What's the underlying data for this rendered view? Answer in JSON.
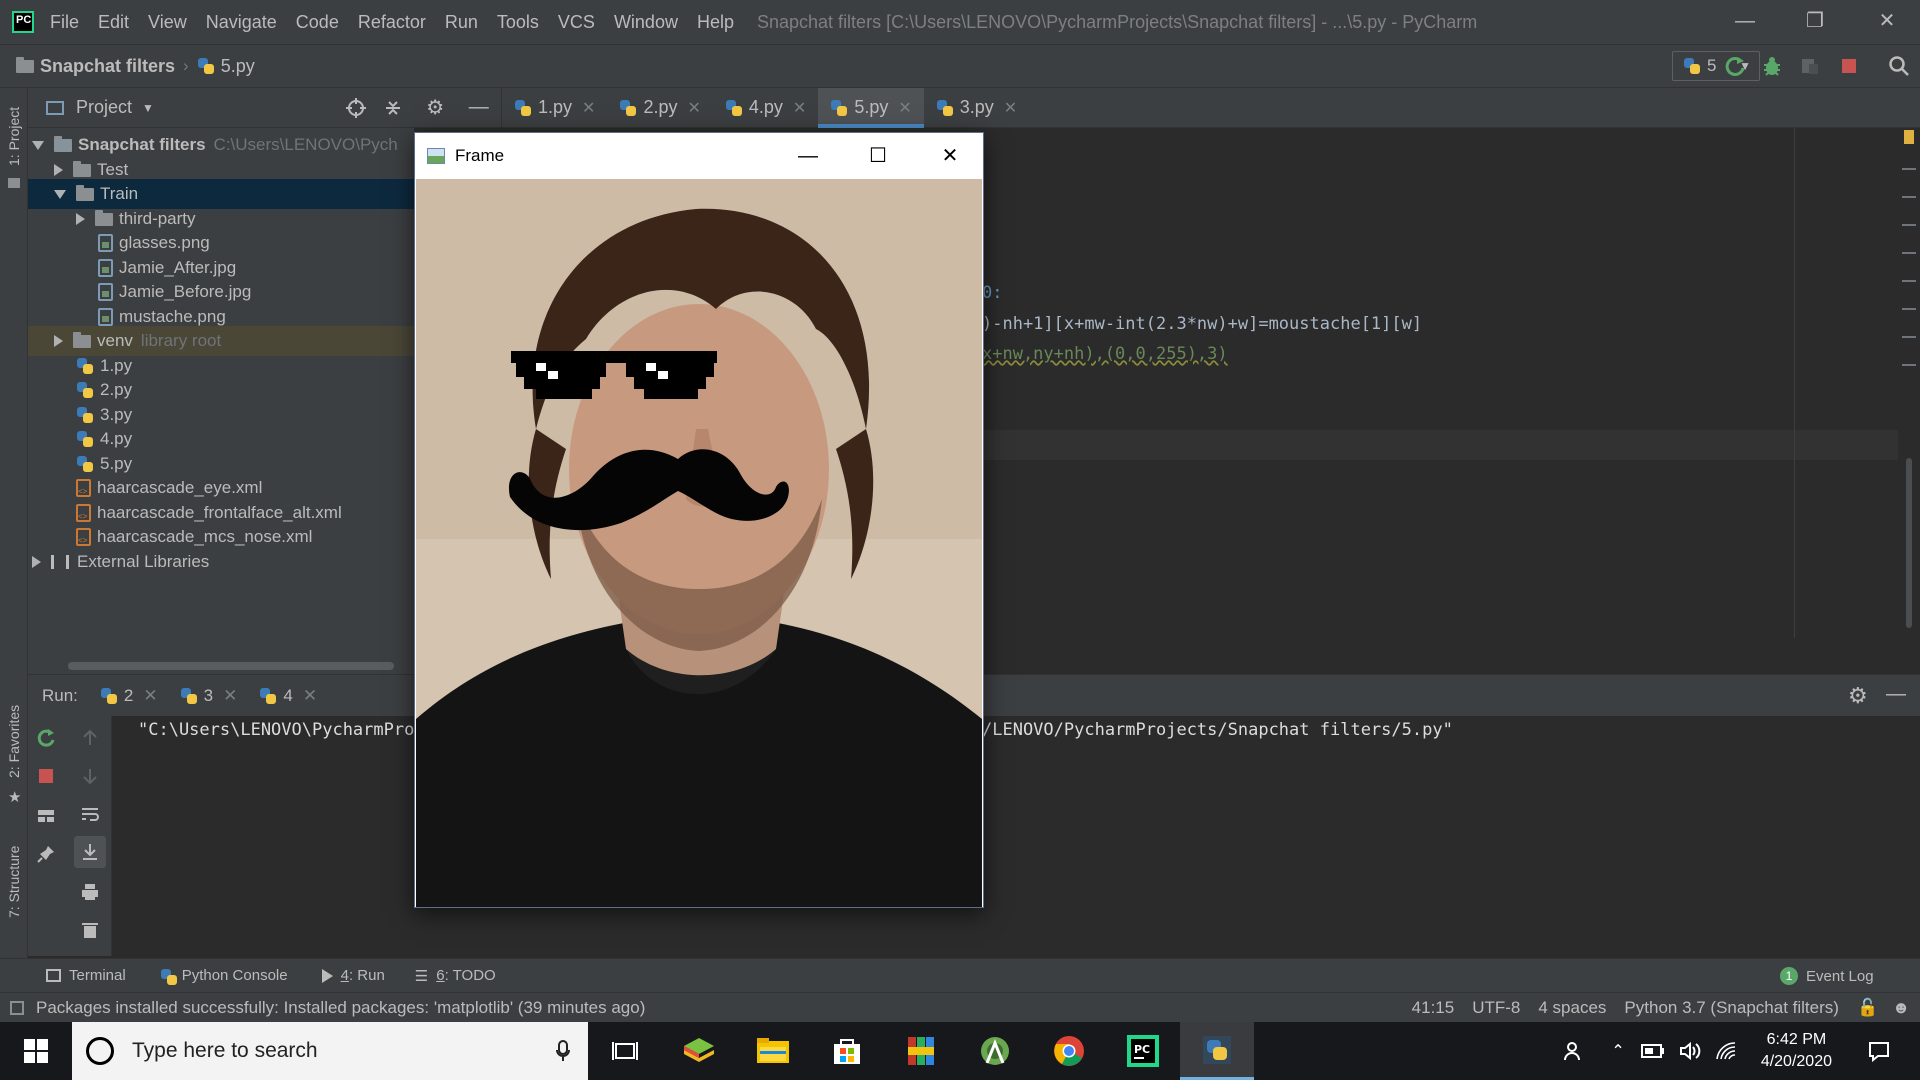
{
  "titlebar": {
    "logo_text": "PC",
    "menu": [
      "File",
      "Edit",
      "View",
      "Navigate",
      "Code",
      "Refactor",
      "Run",
      "Tools",
      "VCS",
      "Window",
      "Help"
    ],
    "window_title": "Snapchat filters [C:\\Users\\LENOVO\\PycharmProjects\\Snapchat filters] - ...\\5.py - PyCharm"
  },
  "navbar": {
    "project": "Snapchat filters",
    "file": "5.py",
    "run_config": "5"
  },
  "sidebar_left": {
    "project_label": "1: Project",
    "favorites_label": "2: Favorites",
    "structure_label": "7: Structure"
  },
  "project_panel": {
    "header": "Project",
    "root_name": "Snapchat filters",
    "root_path": "C:\\Users\\LENOVO\\Pych",
    "items": [
      {
        "name": "Test",
        "kind": "folder"
      },
      {
        "name": "Train",
        "kind": "folder"
      },
      {
        "name": "third-party",
        "kind": "folder"
      },
      {
        "name": "glasses.png",
        "kind": "image"
      },
      {
        "name": "Jamie_After.jpg",
        "kind": "image"
      },
      {
        "name": "Jamie_Before.jpg",
        "kind": "image"
      },
      {
        "name": "mustache.png",
        "kind": "image"
      },
      {
        "name": "venv",
        "kind": "folder"
      },
      {
        "name": "1.py",
        "kind": "python"
      },
      {
        "name": "2.py",
        "kind": "python"
      },
      {
        "name": "3.py",
        "kind": "python"
      },
      {
        "name": "4.py",
        "kind": "python"
      },
      {
        "name": "5.py",
        "kind": "python"
      },
      {
        "name": "haarcascade_eye.xml",
        "kind": "xml"
      },
      {
        "name": "haarcascade_frontalface_alt.xml",
        "kind": "xml"
      },
      {
        "name": "haarcascade_mcs_nose.xml",
        "kind": "xml"
      },
      {
        "name": "External Libraries",
        "kind": "library"
      }
    ],
    "venv_note": "library root"
  },
  "editor_tabs": [
    {
      "label": "1.py",
      "active": false
    },
    {
      "label": "2.py",
      "active": false
    },
    {
      "label": "4.py",
      "active": false
    },
    {
      "label": "5.py",
      "active": true
    },
    {
      "label": "3.py",
      "active": false
    }
  ],
  "editor": {
    "line1": "0:",
    "line2": ")-nh+1][x+mw-int(2.3*nw)+w]=moustache[1][w]",
    "line3": "x+nw,ny+nh),(0,0,255),3)"
  },
  "run_panel": {
    "label": "Run:",
    "tabs": [
      "2",
      "3",
      "4"
    ],
    "output_left": "\"C:\\Users\\LENOVO\\PycharmProj",
    "output_right": "/LENOVO/PycharmProjects/Snapchat filters/5.py\""
  },
  "bottom_tabs": {
    "terminal": "Terminal",
    "python_console": "Python Console",
    "run_num": "4",
    "run": ": Run",
    "todo_num": "6",
    "todo": ": TODO",
    "event_log_count": "1",
    "event_log": "Event Log"
  },
  "statusbar": {
    "message": "Packages installed successfully: Installed packages: 'matplotlib' (39 minutes ago)",
    "position": "41:15",
    "encoding": "UTF-8",
    "indent": "4 spaces",
    "interpreter": "Python 3.7 (Snapchat filters)"
  },
  "frame_window": {
    "title": "Frame"
  },
  "taskbar": {
    "search_placeholder": "Type here to search",
    "time": "6:42 PM",
    "date": "4/20/2020"
  },
  "colors": {
    "ide_bg": "#2b2b2b",
    "panel_bg": "#3c3f41",
    "selection": "#0d293e",
    "active_tab_underline": "#4a88c7",
    "run_green": "#59a869",
    "stop_red": "#c75450"
  }
}
